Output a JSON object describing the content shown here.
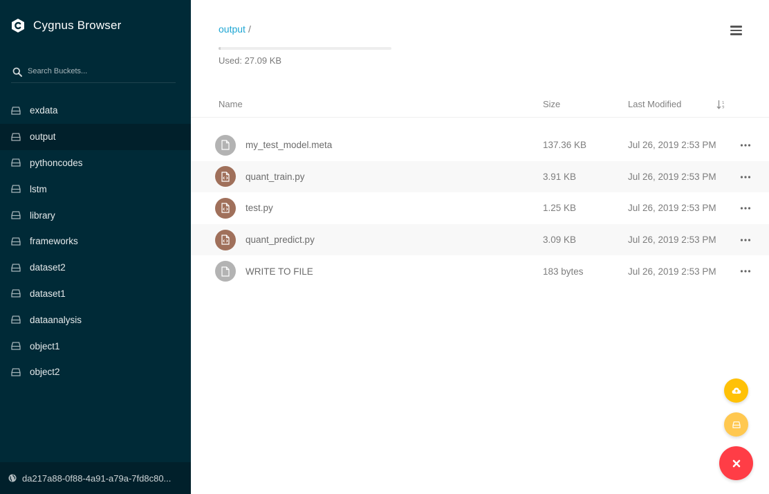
{
  "app": {
    "title": "Cygnus Browser"
  },
  "search": {
    "placeholder": "Search Buckets..."
  },
  "sidebar": {
    "items": [
      {
        "label": "exdata"
      },
      {
        "label": "output"
      },
      {
        "label": "pythoncodes"
      },
      {
        "label": "lstm"
      },
      {
        "label": "library"
      },
      {
        "label": "frameworks"
      },
      {
        "label": "dataset2"
      },
      {
        "label": "dataset1"
      },
      {
        "label": "dataanalysis"
      },
      {
        "label": "object1"
      },
      {
        "label": "object2"
      }
    ],
    "active": "output",
    "host": "da217a88-0f88-4a91-a79a-7fd8c80..."
  },
  "breadcrumb": {
    "current": "output",
    "separator": "/"
  },
  "usage": {
    "label": "Used: 27.09 KB",
    "fraction": 0.01
  },
  "table": {
    "headers": {
      "name": "Name",
      "size": "Size",
      "modified": "Last Modified"
    },
    "rows": [
      {
        "name": "my_test_model.meta",
        "size": "137.36 KB",
        "modified": "Jul 26, 2019 2:53 PM",
        "icon": "file-icon"
      },
      {
        "name": "quant_train.py",
        "size": "3.91 KB",
        "modified": "Jul 26, 2019 2:53 PM",
        "icon": "code-file-icon"
      },
      {
        "name": "test.py",
        "size": "1.25 KB",
        "modified": "Jul 26, 2019 2:53 PM",
        "icon": "code-file-icon"
      },
      {
        "name": "quant_predict.py",
        "size": "3.09 KB",
        "modified": "Jul 26, 2019 2:53 PM",
        "icon": "code-file-icon"
      },
      {
        "name": "WRITE TO FILE",
        "size": "183 bytes",
        "modified": "Jul 26, 2019 2:53 PM",
        "icon": "file-icon"
      }
    ]
  },
  "colors": {
    "sidebar_bg": "#002a37",
    "sidebar_active": "#01202b",
    "link": "#1ea6d3",
    "fab_upload": "#ffc107",
    "fab_bucket": "#ffc850",
    "fab_close": "#ff3d46",
    "code_icon": "#a0705b",
    "file_icon": "#b3b3b3"
  }
}
